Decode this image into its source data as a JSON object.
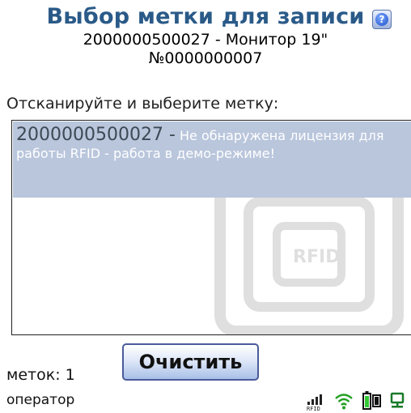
{
  "header": {
    "title": "Выбор метки для записи",
    "item_line": "2000000500027 - Монитор 19\"",
    "doc_number": "№0000000007"
  },
  "prompt": "Отсканируйте и выберите метку:",
  "tag_list": {
    "items": [
      {
        "code": "2000000500027 -",
        "message": "Не обнаружена лицензия для работы RFID - работа в демо-режиме!"
      }
    ]
  },
  "footer": {
    "count_label": "меток: 1",
    "clear_button": "Очистить",
    "user_role": "оператор"
  },
  "status_icons": [
    "rfid-signal-icon",
    "wifi-icon",
    "battery-icon",
    "network-icon"
  ],
  "colors": {
    "title": "#2a5a88",
    "selection": "#b9c6dc",
    "item_code": "#3d4a55",
    "button_border": "#4a5b9a"
  }
}
